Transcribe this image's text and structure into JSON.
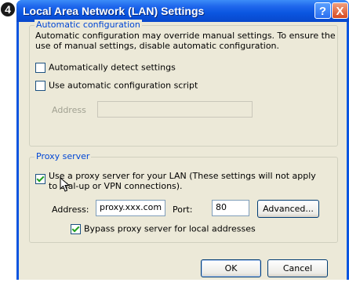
{
  "step": {
    "number": "4"
  },
  "window": {
    "title": "Local Area Network (LAN) Settings",
    "help_glyph": "?",
    "close_glyph": "X"
  },
  "auto_config": {
    "legend": "Automatic configuration",
    "description": "Automatic configuration may override manual settings.  To ensure the use of manual settings, disable automatic configuration.",
    "detect_label": "Automatically detect settings",
    "detect_checked": false,
    "script_label": "Use automatic configuration script",
    "script_checked": false,
    "address_label": "Address",
    "address_value": ""
  },
  "proxy": {
    "legend": "Proxy server",
    "use_label": "Use a proxy server for your LAN (These settings will not apply to dial-up or VPN connections).",
    "use_checked": true,
    "address_label": "Address:",
    "address_value": "proxy.xxx.com",
    "port_label": "Port:",
    "port_value": "80",
    "advanced_label": "Advanced...",
    "bypass_label": "Bypass proxy server for local addresses",
    "bypass_checked": true
  },
  "footer": {
    "ok_label": "OK",
    "cancel_label": "Cancel"
  },
  "colors": {
    "titlebar": "#0a55e0",
    "dialog_bg": "#ece9d8",
    "group_legend": "#0046d5",
    "check": "#21a121"
  }
}
